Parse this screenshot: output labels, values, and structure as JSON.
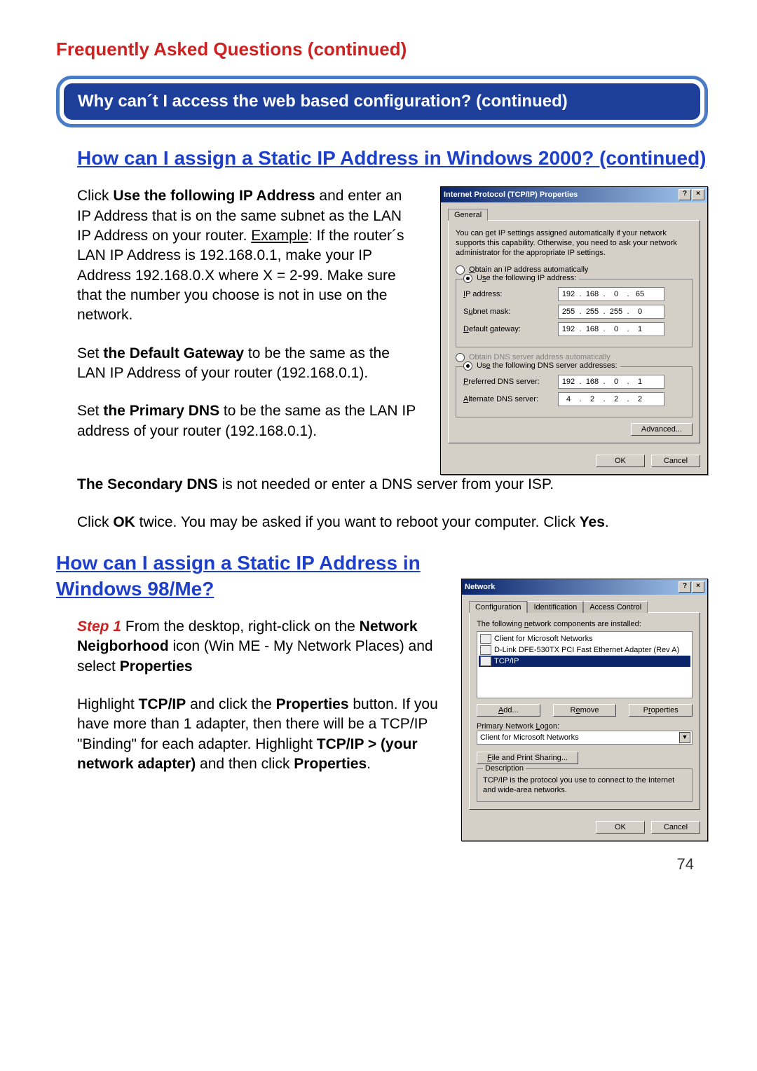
{
  "header": {
    "faq_title": "Frequently Asked Questions (continued)",
    "banner": "Why can´t I access the web based configuration? (continued)"
  },
  "q1": {
    "title": "How can I assign a Static IP Address in Windows 2000? (continued)",
    "p1_a": "Click ",
    "p1_b": "Use the following IP Address",
    "p1_c": " and enter an IP Address that is on the same subnet as the LAN IP Address on your router. ",
    "p1_example": "Example",
    "p1_d": ": If the router´s LAN IP Address is 192.168.0.1, make your IP Address 192.168.0.X where X = 2-99. Make sure that the number you choose is not in use on the network.",
    "p2_a": "Set ",
    "p2_b": "the Default Gateway",
    "p2_c": " to be the same as the LAN IP Address of your router (192.168.0.1).",
    "p3_a": "Set ",
    "p3_b": "the Primary DNS",
    "p3_c": " to be the same as the LAN IP address of your router (192.168.0.1).",
    "p4_a": "The Secondary DNS",
    "p4_b": " is not needed or enter a DNS server from your ISP.",
    "p5_a": "Click ",
    "p5_b": "OK",
    "p5_c": " twice. You may be asked if you want to reboot your computer. Click ",
    "p5_d": "Yes",
    "p5_e": "."
  },
  "dlg1": {
    "title": "Internet Protocol (TCP/IP) Properties",
    "tab": "General",
    "desc": "You can get IP settings assigned automatically if your network supports this capability. Otherwise, you need to ask your network administrator for the appropriate IP settings.",
    "r_auto": "Obtain an IP address automatically",
    "r_manual": "Use the following IP address:",
    "ip_label": "IP address:",
    "ip": [
      "192",
      "168",
      "0",
      "65"
    ],
    "mask_label": "Subnet mask:",
    "mask": [
      "255",
      "255",
      "255",
      "0"
    ],
    "gw_label": "Default gateway:",
    "gw": [
      "192",
      "168",
      "0",
      "1"
    ],
    "r_dns_auto": "Obtain DNS server address automatically",
    "r_dns_manual": "Use the following DNS server addresses:",
    "dns1_label": "Preferred DNS server:",
    "dns1": [
      "192",
      "168",
      "0",
      "1"
    ],
    "dns2_label": "Alternate DNS server:",
    "dns2": [
      "4",
      "2",
      "2",
      "2"
    ],
    "advanced": "Advanced...",
    "ok": "OK",
    "cancel": "Cancel"
  },
  "q2": {
    "title": "How can I assign a Static IP Address in Windows 98/Me?",
    "step1_label": "Step 1",
    "step1_a": " From the desktop, right-click on the ",
    "step1_b": "Network Neigborhood",
    "step1_c": " icon (Win ME - My Network Places) and select ",
    "step1_d": "Properties",
    "p2_a": "Highlight ",
    "p2_b": "TCP/IP",
    "p2_c": " and click the ",
    "p2_d": "Properties",
    "p2_e": " button. If you have more than 1 adapter, then there will be a TCP/IP \"Binding\" for each adapter. Highlight ",
    "p2_f": "TCP/IP > (your network adapter)",
    "p2_g": " and then click ",
    "p2_h": "Properties",
    "p2_i": "."
  },
  "dlg2": {
    "title": "Network",
    "tab1": "Configuration",
    "tab2": "Identification",
    "tab3": "Access Control",
    "list_prompt": "The following network components are installed:",
    "item1": "Client for Microsoft Networks",
    "item2": "D-Link DFE-530TX PCI Fast Ethernet Adapter (Rev A)",
    "item3": "TCP/IP",
    "add": "Add...",
    "remove": "Remove",
    "properties": "Properties",
    "logon_label": "Primary Network Logon:",
    "logon_value": "Client for Microsoft Networks",
    "fps": "File and Print Sharing...",
    "desc_legend": "Description",
    "desc_body": "TCP/IP is the protocol you use to connect to the Internet and wide-area networks.",
    "ok": "OK",
    "cancel": "Cancel"
  },
  "page_number": "74"
}
